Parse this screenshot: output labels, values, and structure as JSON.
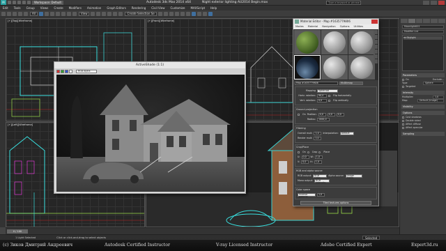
{
  "titlebar": {
    "workspace": "Workspace: Default",
    "app_title": "Autodesk 3ds Max  2014 x64",
    "file_title": "Night exterior lighting AU2014 Begin.max",
    "search_placeholder": "Type a keyword or phrase"
  },
  "menubar": {
    "items": [
      "Edit",
      "Tools",
      "Group",
      "Views",
      "Create",
      "Modifiers",
      "Animation",
      "Graph Editors",
      "Rendering",
      "Civil View",
      "Customize",
      "MAXScript",
      "Help"
    ]
  },
  "toolbar": {
    "filter_value": "All",
    "view_value": "View",
    "selection_set_value": "Create Selection Se"
  },
  "viewports": {
    "top_left_label": "[+][Top][Wireframe]",
    "top_right_label": "[+][Front][Wireframe]",
    "bottom_left_label": "[+][Left][Wireframe]",
    "bottom_right_label": "[+][Camera001][Realistic]"
  },
  "activeshade": {
    "title": "ActiveShade (1:1)",
    "channel_value": "RGB Alpha",
    "swatch_colors": [
      "#d83030",
      "#30a030",
      "#3050d0",
      "#ffffff"
    ]
  },
  "material_editor": {
    "title": "Material Editor - Map #1635779806",
    "menu": [
      "Modes",
      "Material",
      "Navigation",
      "Options",
      "Utilities"
    ],
    "map_name": "Map #1635779806",
    "map_type": "Mr-Bitmap",
    "mapping_label": "Mapping",
    "mapping_value": "Spherical",
    "horiz_rotation_label": "Horiz. rotation:",
    "horiz_rotation_value": "90,0",
    "horiz_flip_label": "Flip horizontally",
    "vert_rotation_label": "Vert. rotation:",
    "vert_rotation_value": "0,0",
    "vert_flip_label": "Flip vertically",
    "ground_projection_label": "Ground projection",
    "on_label": "On",
    "position_label": "Position:",
    "position_values": [
      "0,0",
      "0,0",
      "0,0"
    ],
    "radius_label": "Radius:",
    "radius_value": "1000,0",
    "filtering_label": "Filtering",
    "blur_label": "Overall mult:",
    "blur_value": "1,0",
    "interpolation_label": "Interpolation:",
    "interpolation_value": "Default",
    "render_mult_label": "Render mult:",
    "render_mult_value": "1,0",
    "crop_label": "Crop/Place",
    "crop_on_label": "On",
    "crop_mode_label": "Crop",
    "place_label": "Place",
    "u_label": "U:",
    "u_value": "0,0",
    "w_label": "W:",
    "w_value": "1,0",
    "v_label": "V:",
    "v_value": "0,0",
    "h_label": "H:",
    "h_value": "1,0",
    "rgb_alpha_label": "RGB and alpha source",
    "rgb_output_label": "RGB output:",
    "rgb_output_value": "RGB Color",
    "alpha_source_label": "Alpha source:",
    "alpha_source_value": "Image Alpha",
    "mono_output_label": "Mono output:",
    "mono_output_value": "RGB Intensity",
    "color_space_label": "Color space",
    "gamma_label": "Inverse gamma",
    "gamma_value": "1,0",
    "tiled_button": "Tiled textures options"
  },
  "command_panel": {
    "object_name": "Moonlight001",
    "modifier_list": "Modifier List",
    "stack": [
      "mrSkylight"
    ],
    "parameters_header": "Parameters",
    "on_label": "On",
    "exclude_button": "Exclude...",
    "type_label": "Type",
    "type_value": "Sphere",
    "targeted_label": "Targeted",
    "intensity_label": "Intensity",
    "multiplier_label": "Multiplier:",
    "multiplier_value": "1,0",
    "map_label": "Map:",
    "map_value": "Default (Image)",
    "visibility_label": "Visibility",
    "options_header": "Options",
    "cast_shadows": "Cast shadows",
    "double_sided": "Double sided",
    "affect_diffuse": "Affect diffuse",
    "affect_specular": "Affect specular",
    "sampling_header": "Sampling"
  },
  "timeline": {
    "frame_display": "0 / 100"
  },
  "statusbar": {
    "text": "1 Light Selected",
    "prompt": "Click or click-and-drag to select objects",
    "selected_value": "Selected"
  },
  "footer": {
    "author": "(c) Зиков Дмитрий Андреевич",
    "credit1": "Autodesk Certified Instructor",
    "credit2": "V-ray Licensed Instructor",
    "credit3": "Adobe Certified Expert",
    "site": "Expert3d.ru"
  }
}
